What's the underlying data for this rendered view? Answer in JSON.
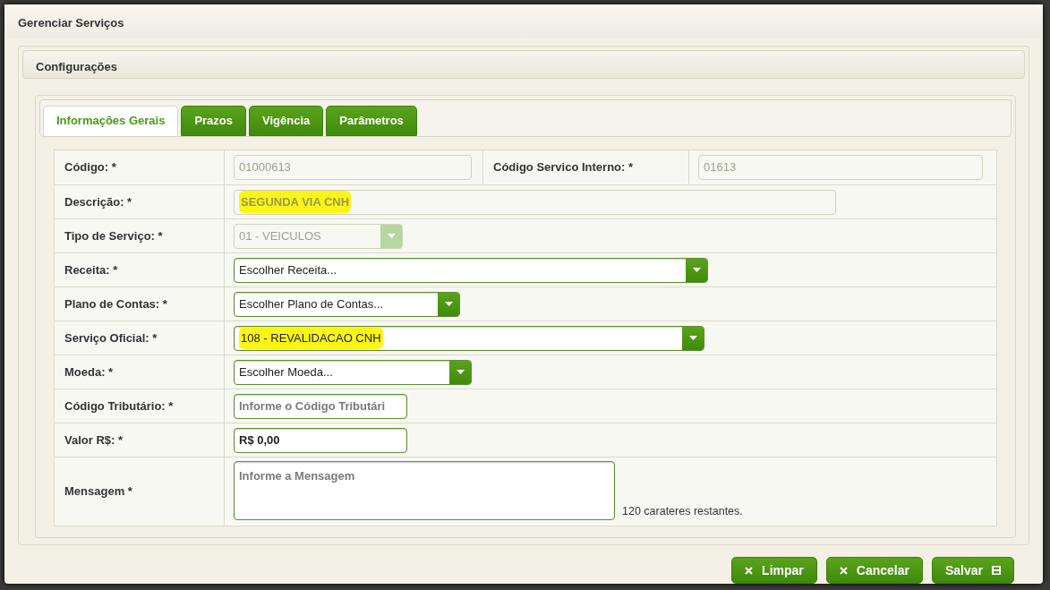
{
  "window": {
    "title": "Gerenciar Serviços"
  },
  "panel": {
    "title": "Configurações"
  },
  "tabs": [
    {
      "label": "Informações Gerais",
      "selected": true
    },
    {
      "label": "Prazos",
      "selected": false
    },
    {
      "label": "Vigência",
      "selected": false
    },
    {
      "label": "Parâmetros",
      "selected": false
    }
  ],
  "rows": [
    {
      "fields": [
        {
          "label": "Código: *",
          "kind": "text",
          "value": "01000613",
          "disabled": true,
          "highlighted": false
        },
        {
          "label": "Código Servico Interno: *",
          "kind": "text",
          "value": "01613",
          "disabled": true,
          "highlighted": false
        }
      ]
    },
    {
      "fields": [
        {
          "label": "Descrição: *",
          "kind": "text",
          "value": "SEGUNDA VIA CNH",
          "disabled": true,
          "highlighted": true
        }
      ]
    },
    {
      "fields": [
        {
          "label": "Tipo de Serviço: *",
          "kind": "select",
          "value": "01 - VEICULOS",
          "disabled": true,
          "highlighted": false
        }
      ]
    },
    {
      "fields": [
        {
          "label": "Receita: *",
          "kind": "select",
          "placeholder": "Escolher Receita...",
          "disabled": false,
          "highlighted": false
        }
      ]
    },
    {
      "fields": [
        {
          "label": "Plano de Contas: *",
          "kind": "select",
          "placeholder": "Escolher Plano de Contas...",
          "disabled": false,
          "highlighted": false
        }
      ]
    },
    {
      "fields": [
        {
          "label": "Serviço Oficial: *",
          "kind": "select",
          "value": "108 - REVALIDACAO CNH",
          "disabled": false,
          "highlighted": true
        }
      ]
    },
    {
      "fields": [
        {
          "label": "Moeda: *",
          "kind": "select",
          "placeholder": "Escolher Moeda...",
          "disabled": false,
          "highlighted": false
        }
      ]
    },
    {
      "fields": [
        {
          "label": "Código Tributário: *",
          "kind": "text",
          "placeholder": "Informe o Código Tributári",
          "disabled": false,
          "highlighted": false
        }
      ]
    },
    {
      "fields": [
        {
          "label": "Valor R$: *",
          "kind": "text",
          "value": "R$ 0,00",
          "disabled": false,
          "highlighted": false
        }
      ]
    },
    {
      "fields": [
        {
          "label": "Mensagem *",
          "kind": "textarea",
          "placeholder": "Informe a Mensagem",
          "counter": "120 carateres restantes.",
          "disabled": false,
          "highlighted": false
        }
      ]
    }
  ],
  "buttons": [
    {
      "label": "Limpar",
      "kind": "clear"
    },
    {
      "label": "Cancelar",
      "kind": "cancel"
    },
    {
      "label": "Salvar",
      "kind": "save"
    }
  ]
}
